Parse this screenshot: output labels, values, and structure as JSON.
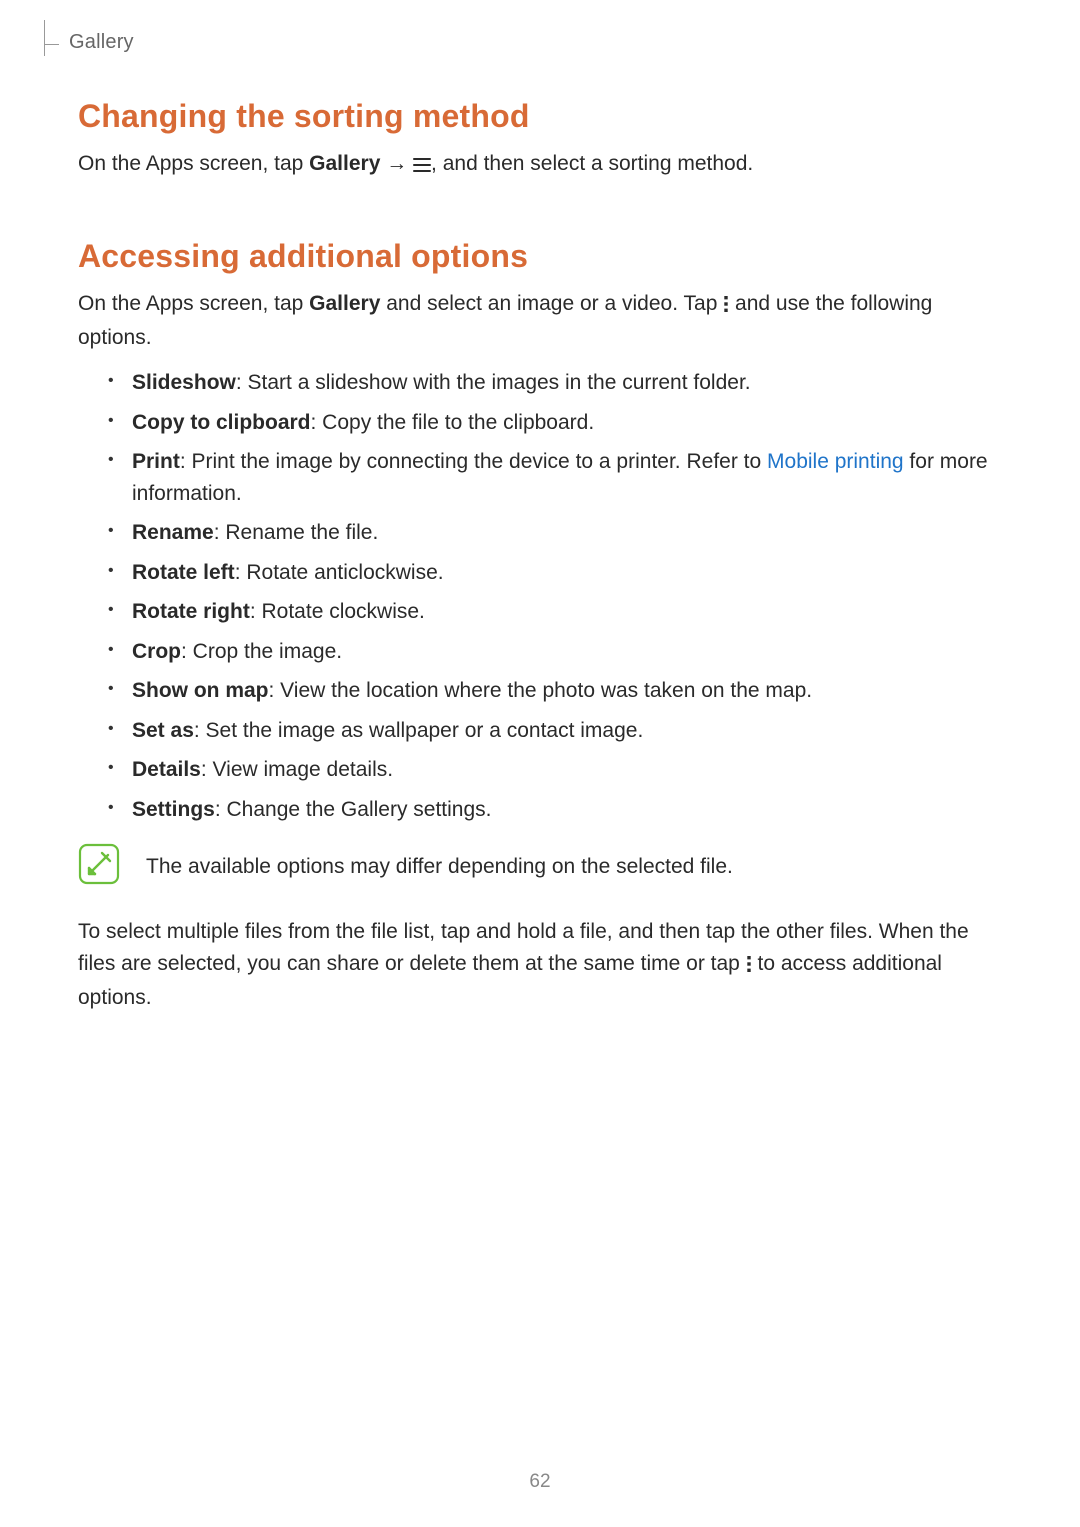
{
  "header": {
    "section": "Gallery"
  },
  "section1": {
    "title": "Changing the sorting method",
    "para_prefix": "On the Apps screen, tap ",
    "gallery_word": "Gallery",
    "arrow": " → ",
    "para_suffix": ", and then select a sorting method."
  },
  "section2": {
    "title": "Accessing additional options",
    "para_prefix": "On the Apps screen, tap ",
    "gallery_word": "Gallery",
    "para_mid": " and select an image or a video. Tap ",
    "para_suffix": " and use the following options.",
    "items": [
      {
        "term": "Slideshow",
        "desc": ": Start a slideshow with the images in the current folder."
      },
      {
        "term": "Copy to clipboard",
        "desc": ": Copy the file to the clipboard."
      },
      {
        "term": "Print",
        "desc_before": ": Print the image by connecting the device to a printer. Refer to ",
        "link_text": "Mobile printing",
        "desc_after": " for more information."
      },
      {
        "term": "Rename",
        "desc": ": Rename the file."
      },
      {
        "term": "Rotate left",
        "desc": ": Rotate anticlockwise."
      },
      {
        "term": "Rotate right",
        "desc": ": Rotate clockwise."
      },
      {
        "term": "Crop",
        "desc": ": Crop the image."
      },
      {
        "term": "Show on map",
        "desc": ": View the location where the photo was taken on the map."
      },
      {
        "term": "Set as",
        "desc": ": Set the image as wallpaper or a contact image."
      },
      {
        "term": "Details",
        "desc": ": View image details."
      },
      {
        "term": "Settings",
        "desc": ": Change the Gallery settings."
      }
    ],
    "note": "The available options may differ depending on the selected file.",
    "followup_a": "To select multiple files from the file list, tap and hold a file, and then tap the other files. When the files are selected, you can share or delete them at the same time or tap ",
    "followup_b": " to access additional options."
  },
  "page_number": "62"
}
